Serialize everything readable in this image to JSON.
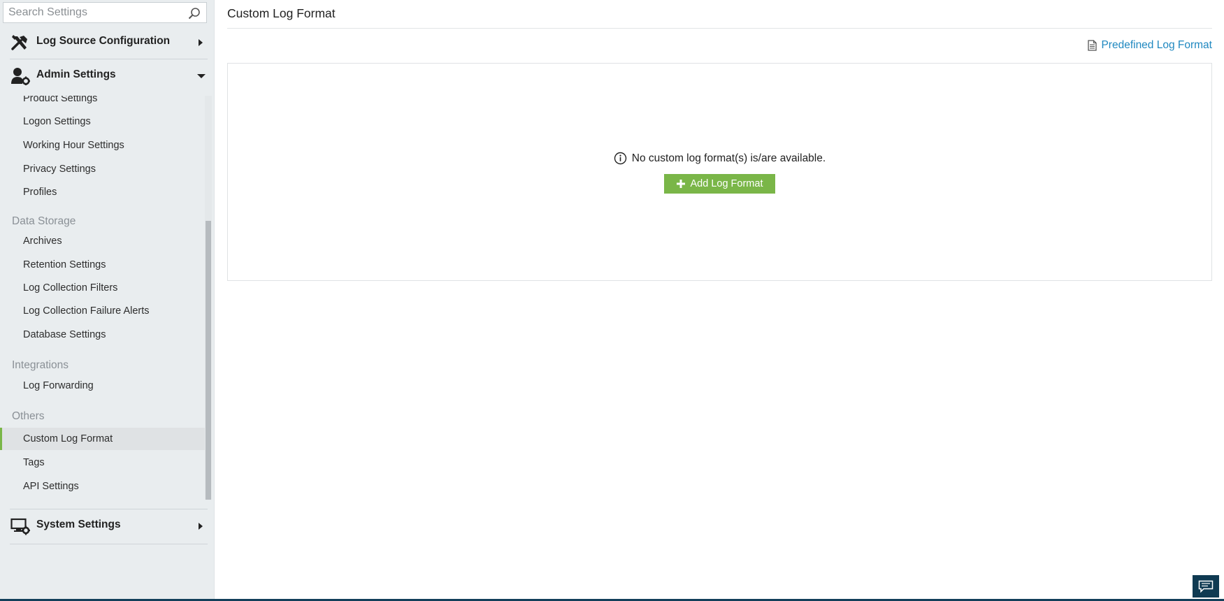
{
  "search": {
    "placeholder": "Search Settings"
  },
  "sidebar": {
    "sections": [
      {
        "label": "Log Source Configuration",
        "icon": "tools-icon",
        "state": "collapsed"
      },
      {
        "label": "Admin Settings",
        "icon": "user-gear-icon",
        "state": "expanded"
      },
      {
        "label": "System Settings",
        "icon": "monitor-gear-icon",
        "state": "collapsed"
      }
    ],
    "admin_items": {
      "product_settings": "Product Settings",
      "logon_settings": "Logon Settings",
      "working_hour_settings": "Working Hour Settings",
      "privacy_settings": "Privacy Settings",
      "profiles": "Profiles",
      "group_data_storage": "Data Storage",
      "archives": "Archives",
      "retention_settings": "Retention Settings",
      "log_collection_filters": "Log Collection Filters",
      "log_collection_failure_alerts": "Log Collection Failure Alerts",
      "database_settings": "Database Settings",
      "group_integrations": "Integrations",
      "log_forwarding": "Log Forwarding",
      "group_others": "Others",
      "custom_log_format": "Custom Log Format",
      "tags": "Tags",
      "api_settings": "API Settings"
    },
    "active_item": "Custom Log Format"
  },
  "main": {
    "title": "Custom Log Format",
    "predefined_link": "Predefined Log Format",
    "empty_message": "No custom log format(s) is/are available.",
    "add_button": "Add Log Format"
  },
  "colors": {
    "accent_green": "#7ab648",
    "link_blue": "#1f88c0",
    "sidebar_bg": "#e9edef",
    "footer_navy": "#0f3a52"
  }
}
